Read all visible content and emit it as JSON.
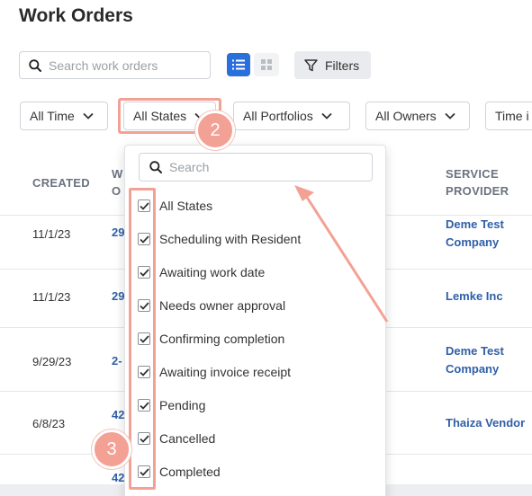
{
  "header": {
    "title": "Work Orders"
  },
  "search": {
    "placeholder": "Search work orders",
    "value": ""
  },
  "toolbar": {
    "filters_label": "Filters"
  },
  "filter_chips": {
    "time": "All Time",
    "states": "All States",
    "portfolios": "All Portfolios",
    "owners": "All Owners",
    "time_in": "Time i"
  },
  "table": {
    "columns": {
      "created": "CREATED",
      "wo_partial_1": "W",
      "wo_partial_2": "O",
      "service_provider_1": "SERVICE",
      "service_provider_2": "PROVIDER"
    },
    "rows": [
      {
        "created": "11/1/23",
        "id": "29",
        "provider_1": "Deme Test",
        "provider_2": "Company"
      },
      {
        "created": "11/1/23",
        "id": "29",
        "provider_1": "Lemke Inc",
        "provider_2": ""
      },
      {
        "created": "9/29/23",
        "id": "2-",
        "provider_1": "Deme Test",
        "provider_2": "Company"
      },
      {
        "created": "6/8/23",
        "id": "42",
        "provider_1": "Thaiza Vendor",
        "provider_2": ""
      },
      {
        "created": "",
        "id": "42",
        "provider_1": "",
        "provider_2": ""
      }
    ]
  },
  "dropdown": {
    "search_placeholder": "Search",
    "items": [
      {
        "label": "All States",
        "checked": true
      },
      {
        "label": "Scheduling with Resident",
        "checked": true
      },
      {
        "label": "Awaiting work date",
        "checked": true
      },
      {
        "label": "Needs owner approval",
        "checked": true
      },
      {
        "label": "Confirming completion",
        "checked": true
      },
      {
        "label": "Awaiting invoice receipt",
        "checked": true
      },
      {
        "label": "Pending",
        "checked": true
      },
      {
        "label": "Cancelled",
        "checked": true
      },
      {
        "label": "Completed",
        "checked": true
      }
    ]
  },
  "annotations": {
    "badge_2": "2",
    "badge_3": "3"
  },
  "colors": {
    "accent": "#2a6fdb",
    "link": "#2f5fa7",
    "highlight": "#f4a195"
  }
}
